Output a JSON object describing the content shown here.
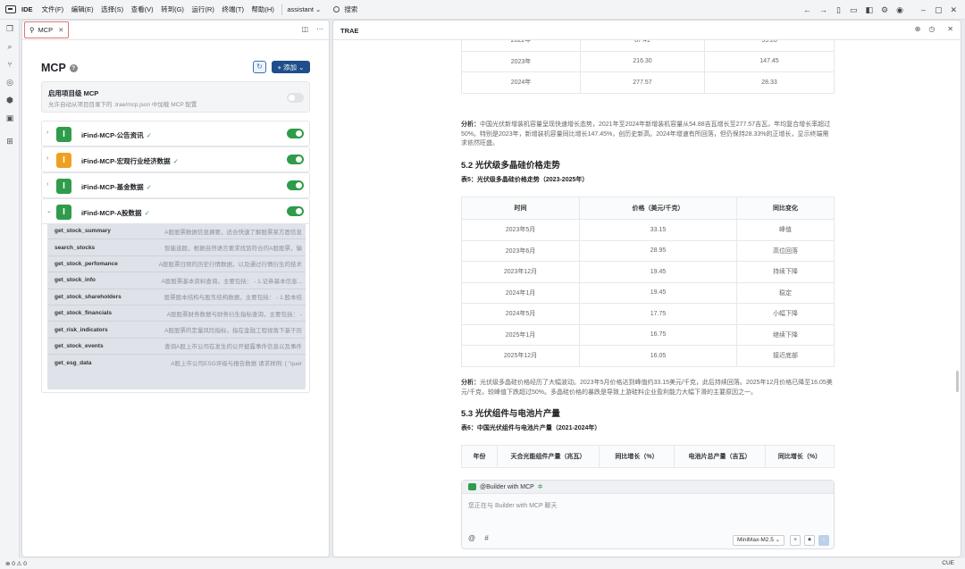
{
  "titlebar": {
    "ide": "IDE",
    "menus": [
      "文件(F)",
      "编辑(E)",
      "选择(S)",
      "查看(V)",
      "转到(G)",
      "运行(R)",
      "终端(T)",
      "帮助(H)"
    ],
    "assistant": "assistant ⌄",
    "search": "搜索"
  },
  "left": {
    "tab": "MCP",
    "title": "MCP",
    "add_label": "+ 添加 ⌄",
    "project": {
      "title": "启用项目级 MCP",
      "desc": "允许自动从项目目录下的 .trae/mcp.json 中加载 MCP 配置"
    },
    "servers": [
      {
        "name": "iFind-MCP-公告资讯",
        "color": "#2e9c4a",
        "expanded": false
      },
      {
        "name": "iFind-MCP-宏观行业经济数据",
        "color": "#f0a020",
        "expanded": false
      },
      {
        "name": "iFind-MCP-基金数据",
        "color": "#2e9c4a",
        "expanded": false
      },
      {
        "name": "iFind-MCP-A股数据",
        "color": "#2e9c4a",
        "expanded": true
      }
    ],
    "tools": [
      {
        "name": "get_stock_summary",
        "desc": "A股股票数据信息摘要，适合快速了解股票某方面信息"
      },
      {
        "name": "search_stocks",
        "desc": "智能选股，根据自然语言要求找到符合的A股股票，输"
      },
      {
        "name": "get_stock_perfomance",
        "desc": "A股股票日频的历史行情数据，以及通过行情衍生的技术"
      },
      {
        "name": "get_stock_info",
        "desc": "A股股票基本资料查询，主要包括： - 1.证券基本信息..."
      },
      {
        "name": "get_stock_shareholders",
        "desc": "股票股本结构与股东结构数据，主要包括： - 1.股本结"
      },
      {
        "name": "get_stock_financials",
        "desc": "A股股票财务数据与财务衍生指标查询，主要包括： -"
      },
      {
        "name": "get_risk_indicators",
        "desc": "A股股票的定量风险指标，指在金融工程视角下基于历"
      },
      {
        "name": "get_stock_events",
        "desc": "查询A股上市公司在发生的公开披露事件信息以及事件"
      },
      {
        "name": "get_esg_data",
        "desc": "A股上市公司ESG评级与报告数据 请求样例: { \"quer"
      }
    ]
  },
  "right": {
    "title": "TRAE",
    "table_top": [
      [
        "2022年",
        "87.41",
        "59.28"
      ],
      [
        "2023年",
        "216.30",
        "147.45"
      ],
      [
        "2024年",
        "277.57",
        "28.33"
      ]
    ],
    "analysis1_label": "分析：",
    "analysis1": "中国光伏新增装机容量呈现快速增长态势，2021年至2024年新增装机容量从54.88吉瓦增长至277.57吉瓦，年均复合增长率超过50%。特别是2023年，新增装机容量同比增长147.45%，创历史新高。2024年增速有所回落，但仍保持28.33%的正增长，显示终端需求依然旺盛。",
    "h52": "5.2 光伏级多晶硅价格走势",
    "cap5": "表5：光伏级多晶硅价格走势（2023-2025年）",
    "t5_head": [
      "时间",
      "价格（美元/千克）",
      "同比变化"
    ],
    "t5_rows": [
      [
        "2023年5月",
        "33.15",
        "峰值"
      ],
      [
        "2023年6月",
        "28.95",
        "高位回落"
      ],
      [
        "2023年12月",
        "19.45",
        "持续下降"
      ],
      [
        "2024年1月",
        "19.45",
        "稳定"
      ],
      [
        "2024年5月",
        "17.75",
        "小幅下降"
      ],
      [
        "2025年1月",
        "16.75",
        "继续下降"
      ],
      [
        "2025年12月",
        "16.05",
        "接近底部"
      ]
    ],
    "analysis2_label": "分析：",
    "analysis2": "光伏级多晶硅价格经历了大幅波动。2023年5月价格达到峰值约33.15美元/千克，此后持续回落。2025年12月价格已降至16.05美元/千克，较峰值下跌超过50%。多晶硅价格的暴跌是导致上游硅料企业盈利能力大幅下滑的主要原因之一。",
    "h53": "5.3 光伏组件与电池片产量",
    "cap6": "表6：中国光伏组件与电池片产量（2021-2024年）",
    "t6_head": [
      "年份",
      "天合光能组件产量（兆瓦）",
      "同比增长（%）",
      "电池片总产量（吉瓦）",
      "同比增长（%）"
    ],
    "chat": {
      "header": "@Builder with MCP",
      "placeholder": "您正在与 Builder with MCP 聊天",
      "model": "MiniMax-M2.5 ⌄"
    }
  },
  "status": {
    "left": "⊗ 0 ⚠ 0",
    "right": "CUE"
  }
}
